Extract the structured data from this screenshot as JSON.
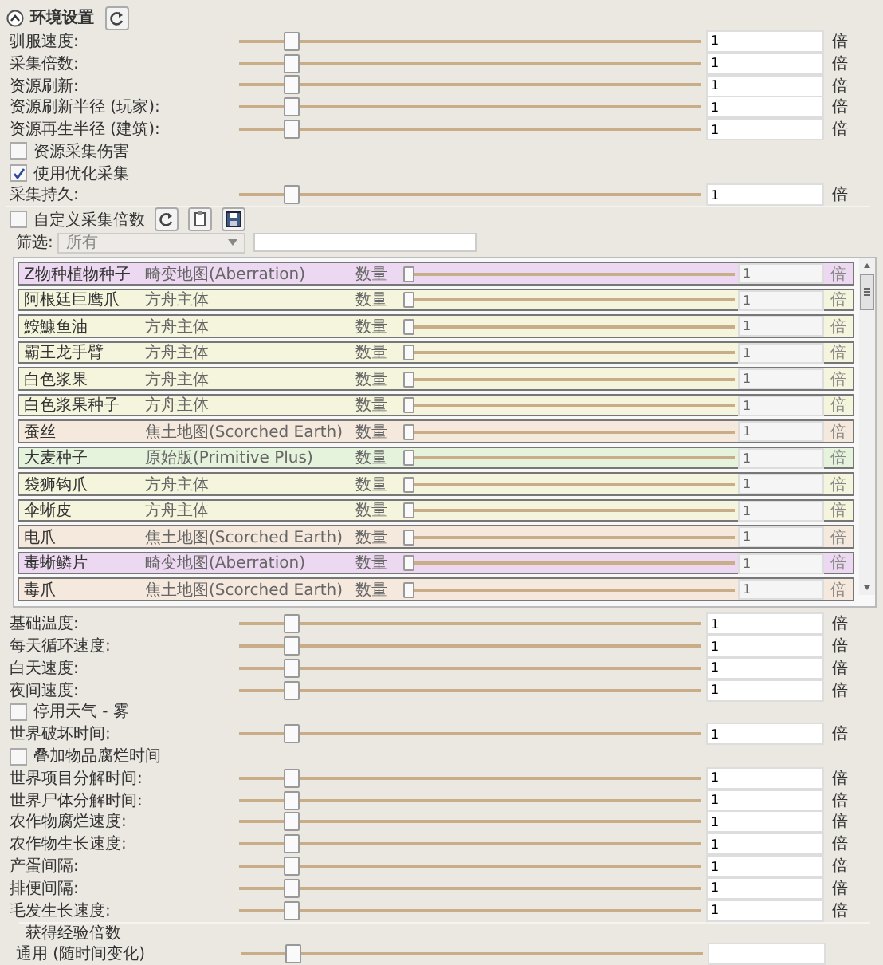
{
  "section": {
    "title": "环境设置",
    "expanded": true
  },
  "settings": [
    {
      "kind": "slider",
      "label": "驯服速度:",
      "level": 0.1,
      "value": "1",
      "unit": "倍"
    },
    {
      "kind": "slider",
      "label": "采集倍数:",
      "level": 0.1,
      "value": "1",
      "unit": "倍"
    },
    {
      "kind": "slider",
      "label": "资源刷新:",
      "level": 0.1,
      "value": "1",
      "unit": "倍"
    },
    {
      "kind": "slider",
      "label": "资源刷新半径 (玩家):",
      "level": 0.1,
      "value": "1",
      "unit": "倍"
    },
    {
      "kind": "slider",
      "label": "资源再生半径 (建筑):",
      "level": 0.1,
      "value": "1",
      "unit": "倍"
    },
    {
      "kind": "checkbox",
      "label": "资源采集伤害",
      "checked": false
    },
    {
      "kind": "checkbox",
      "label": "使用优化采集",
      "checked": true
    },
    {
      "kind": "slider",
      "label": "采集持久:",
      "level": 0.1,
      "value": "1",
      "unit": "倍"
    }
  ],
  "custom": {
    "label": "自定义采集倍数",
    "checked": false
  },
  "filter": {
    "label": "筛选:",
    "dropdown": "所有"
  },
  "resources": [
    {
      "name": "Z物种植物种子",
      "map": "畸变地图(Aberration)",
      "quantity": "数量",
      "level": 0,
      "value": "1",
      "unit": "倍",
      "color": "#ecd8f0"
    },
    {
      "name": "阿根廷巨鹰爪",
      "map": "方舟主体",
      "quantity": "数量",
      "level": 0,
      "value": "1",
      "unit": "倍",
      "color": "#f5f4dc"
    },
    {
      "name": "鮟鱇鱼油",
      "map": "方舟主体",
      "quantity": "数量",
      "level": 0,
      "value": "1",
      "unit": "倍",
      "color": "#f5f4dc"
    },
    {
      "name": "霸王龙手臂",
      "map": "方舟主体",
      "quantity": "数量",
      "level": 0,
      "value": "1",
      "unit": "倍",
      "color": "#f5f4dc"
    },
    {
      "name": "白色浆果",
      "map": "方舟主体",
      "quantity": "数量",
      "level": 0,
      "value": "1",
      "unit": "倍",
      "color": "#f5f4dc"
    },
    {
      "name": "白色浆果种子",
      "map": "方舟主体",
      "quantity": "数量",
      "level": 0,
      "value": "1",
      "unit": "倍",
      "color": "#f5f4dc"
    },
    {
      "name": "蚕丝",
      "map": "焦土地图(Scorched Earth)",
      "quantity": "数量",
      "level": 0,
      "value": "1",
      "unit": "倍",
      "color": "#f5e8dc"
    },
    {
      "name": "大麦种子",
      "map": "原始版(Primitive Plus)",
      "quantity": "数量",
      "level": 0,
      "value": "1",
      "unit": "倍",
      "color": "#e5f2dc"
    },
    {
      "name": "袋狮钩爪",
      "map": "方舟主体",
      "quantity": "数量",
      "level": 0,
      "value": "1",
      "unit": "倍",
      "color": "#f5f4dc"
    },
    {
      "name": "伞蜥皮",
      "map": "方舟主体",
      "quantity": "数量",
      "level": 0,
      "value": "1",
      "unit": "倍",
      "color": "#f5f4dc"
    },
    {
      "name": "电爪",
      "map": "焦土地图(Scorched Earth)",
      "quantity": "数量",
      "level": 0,
      "value": "1",
      "unit": "倍",
      "color": "#f5e8dc"
    },
    {
      "name": "毒蜥鳞片",
      "map": "畸变地图(Aberration)",
      "quantity": "数量",
      "level": 0,
      "value": "1",
      "unit": "倍",
      "color": "#ecd8f0"
    },
    {
      "name": "毒爪",
      "map": "焦土地图(Scorched Earth)",
      "quantity": "数量",
      "level": 0,
      "value": "1",
      "unit": "倍",
      "color": "#f5e8dc"
    }
  ],
  "settings_after": [
    {
      "kind": "slider",
      "label": "基础温度:",
      "level": 0.1,
      "value": "1",
      "unit": "倍"
    },
    {
      "kind": "slider",
      "label": "每天循环速度:",
      "level": 0.1,
      "value": "1",
      "unit": "倍"
    },
    {
      "kind": "slider",
      "label": "白天速度:",
      "level": 0.1,
      "value": "1",
      "unit": "倍"
    },
    {
      "kind": "slider",
      "label": "夜间速度:",
      "level": 0.1,
      "value": "1",
      "unit": "倍"
    },
    {
      "kind": "checkbox",
      "label": "停用天气 - 雾",
      "checked": false
    },
    {
      "kind": "slider",
      "label": "世界破坏时间:",
      "level": 0.1,
      "value": "1",
      "unit": "倍"
    },
    {
      "kind": "checkbox",
      "label": "叠加物品腐烂时间",
      "checked": false
    },
    {
      "kind": "slider",
      "label": "世界项目分解时间:",
      "level": 0.1,
      "value": "1",
      "unit": "倍"
    },
    {
      "kind": "slider",
      "label": "世界尸体分解时间:",
      "level": 0.1,
      "value": "1",
      "unit": "倍"
    },
    {
      "kind": "slider",
      "label": "农作物腐烂速度:",
      "level": 0.1,
      "value": "1",
      "unit": "倍"
    },
    {
      "kind": "slider",
      "label": "农作物生长速度:",
      "level": 0.1,
      "value": "1",
      "unit": "倍"
    },
    {
      "kind": "slider",
      "label": "产蛋间隔:",
      "level": 0.1,
      "value": "1",
      "unit": "倍"
    },
    {
      "kind": "slider",
      "label": "排便间隔:",
      "level": 0.1,
      "value": "1",
      "unit": "倍"
    },
    {
      "kind": "slider",
      "label": "毛发生长速度:",
      "level": 0.1,
      "value": "1",
      "unit": "倍"
    }
  ],
  "experience": {
    "title": "获得经验倍数",
    "settings": [
      {
        "kind": "slider",
        "label": "通用 (随时间变化)",
        "level": 0.1
      }
    ]
  }
}
